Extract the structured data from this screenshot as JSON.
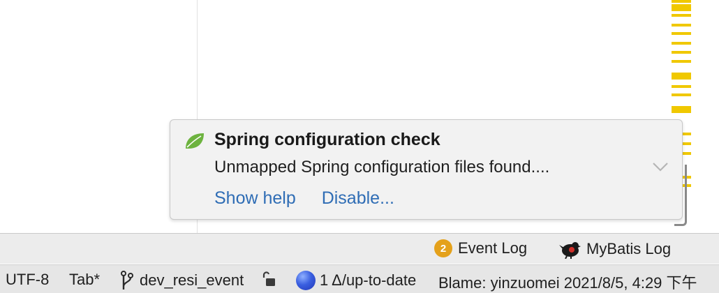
{
  "notification": {
    "title": "Spring configuration check",
    "body": "Unmapped Spring configuration files found....",
    "links": [
      "Show help",
      "Disable..."
    ],
    "icon": "spring-leaf-icon"
  },
  "tool_strip": {
    "event_log": {
      "badge": "2",
      "label": "Event Log"
    },
    "mybatis_log": {
      "label": "MyBatis Log",
      "icon": "mybatis-bird-icon"
    }
  },
  "status_bar": {
    "encoding": "UTF-8",
    "indent": "Tab*",
    "branch": "dev_resi_event",
    "vcs_status": "1 Δ/up-to-date",
    "blame": "Blame: yinzuomei 2021/8/5, 4:29 下午"
  },
  "colors": {
    "link": "#2f6db5",
    "badge": "#e4a11b",
    "error_stripe": "#f0c800",
    "spring_leaf": "#6db33f"
  }
}
